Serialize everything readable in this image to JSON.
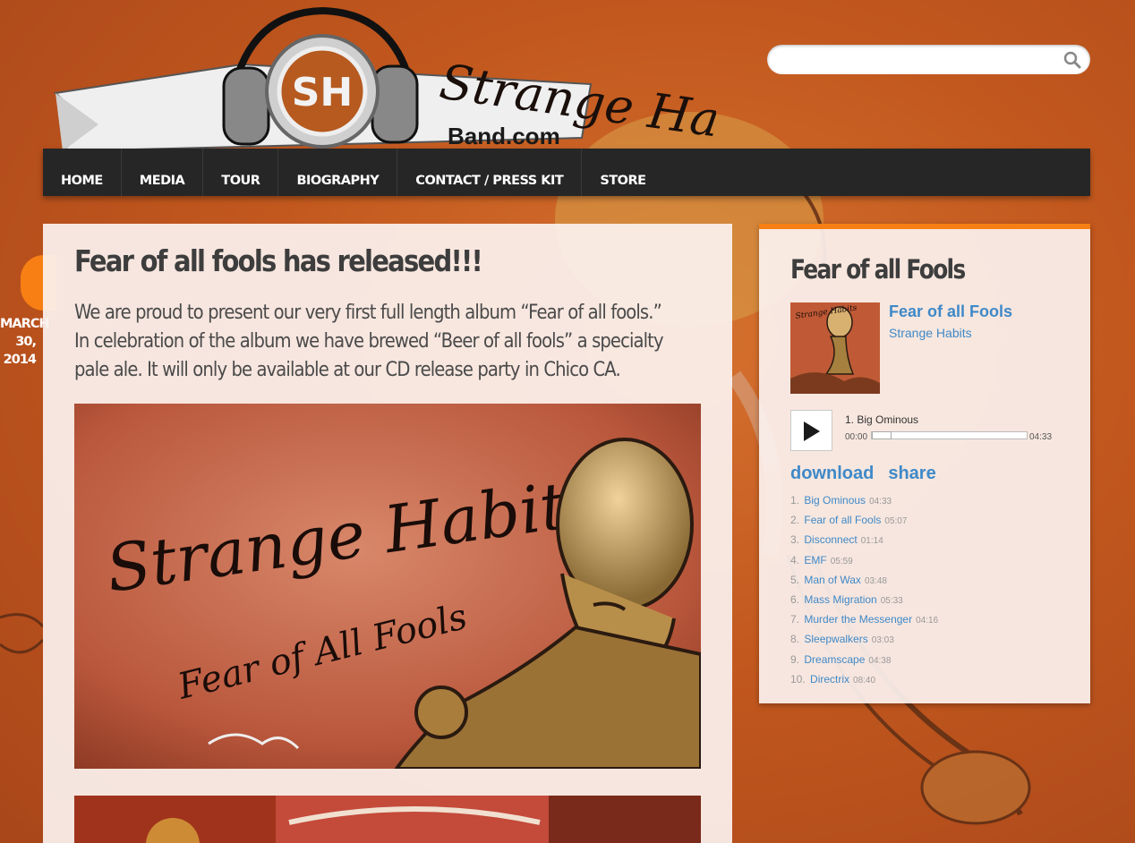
{
  "header": {
    "logo_monogram": "SH",
    "logo_name": "Strange Habits",
    "logo_domain": "Band.com",
    "search": {
      "placeholder": "",
      "value": ""
    }
  },
  "nav": {
    "items": [
      "HOME",
      "MEDIA",
      "TOUR",
      "BIOGRAPHY",
      "CONTACT / PRESS KIT",
      "STORE"
    ]
  },
  "post": {
    "date": {
      "month": "MARCH",
      "day": "30,",
      "year": "2014"
    },
    "title": "Fear of all fools has released!!!",
    "body": "We are proud to present our very first full length album “Fear of all fools.” In celebration of the album we have brewed “Beer of all fools” a specialty pale ale. It will only be available at our CD release party in Chico CA.",
    "album_art_text": {
      "band": "Strange Habits",
      "album": "Fear of All Fools"
    }
  },
  "widget": {
    "title": "Fear of all Fools",
    "album": "Fear of all Fools",
    "artist": "Strange Habits",
    "player": {
      "now_playing": "1. Big Ominous",
      "time_current": "00:00",
      "time_total": "04:33",
      "progress": 0
    },
    "links": {
      "download": "download",
      "share": "share"
    },
    "tracks": [
      {
        "num": "1.",
        "title": "Big Ominous",
        "duration": "04:33"
      },
      {
        "num": "2.",
        "title": "Fear of all Fools",
        "duration": "05:07"
      },
      {
        "num": "3.",
        "title": "Disconnect",
        "duration": "01:14"
      },
      {
        "num": "4.",
        "title": "EMF",
        "duration": "05:59"
      },
      {
        "num": "5.",
        "title": "Man of Wax",
        "duration": "03:48"
      },
      {
        "num": "6.",
        "title": "Mass Migration",
        "duration": "05:33"
      },
      {
        "num": "7.",
        "title": "Murder the Messenger",
        "duration": "04:16"
      },
      {
        "num": "8.",
        "title": "Sleepwalkers",
        "duration": "03:03"
      },
      {
        "num": "9.",
        "title": "Dreamscape",
        "duration": "04:38"
      },
      {
        "num": "10.",
        "title": "Directrix",
        "duration": "08:40"
      }
    ]
  },
  "colors": {
    "accent": "#f77f14",
    "link": "#3f89c8",
    "nav_bg": "#262626",
    "background": "#c2581e"
  }
}
